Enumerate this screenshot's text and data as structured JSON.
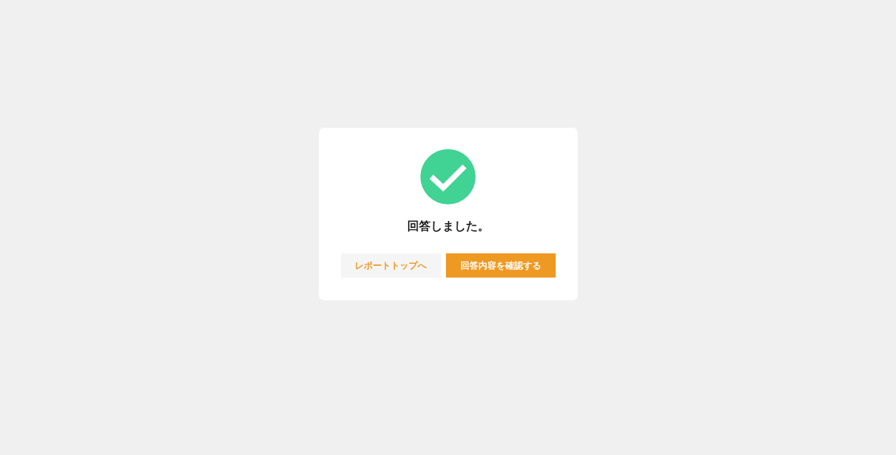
{
  "dialog": {
    "message": "回答しました。",
    "buttons": [
      {
        "label": "レポートトップへ",
        "kind": "secondary"
      },
      {
        "label": "回答内容を確認する",
        "kind": "primary"
      }
    ]
  }
}
